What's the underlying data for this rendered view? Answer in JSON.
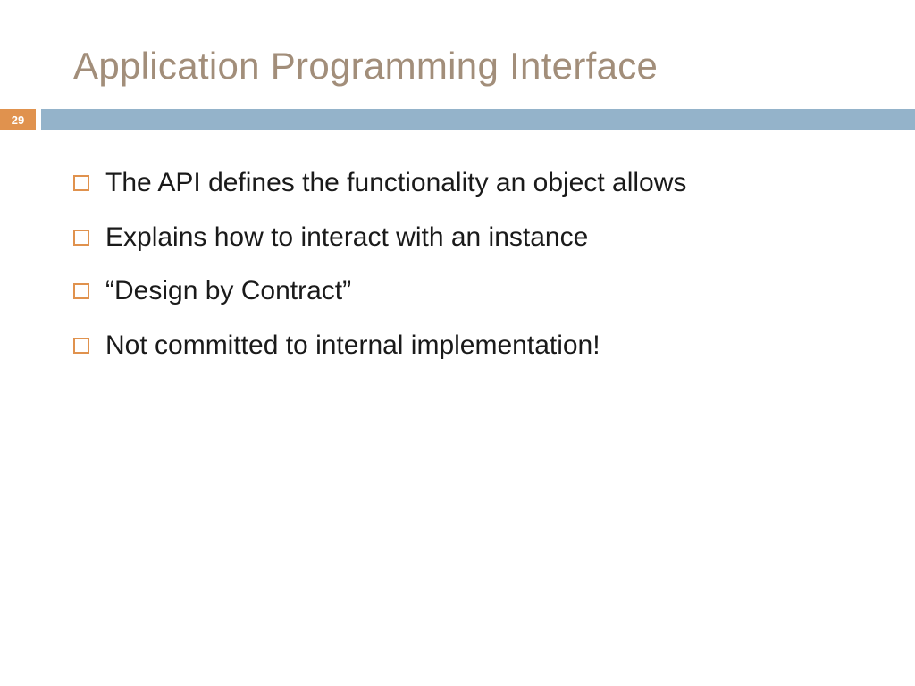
{
  "slide": {
    "title": "Application Programming Interface",
    "page_number": "29",
    "bullets": [
      "The API defines the functionality an object allows",
      "Explains how to interact with an instance",
      "“Design by Contract”",
      "Not committed to internal implementation!"
    ]
  },
  "colors": {
    "title": "#a28e7a",
    "accent_orange": "#e0924e",
    "accent_blue": "#94b3ca"
  }
}
